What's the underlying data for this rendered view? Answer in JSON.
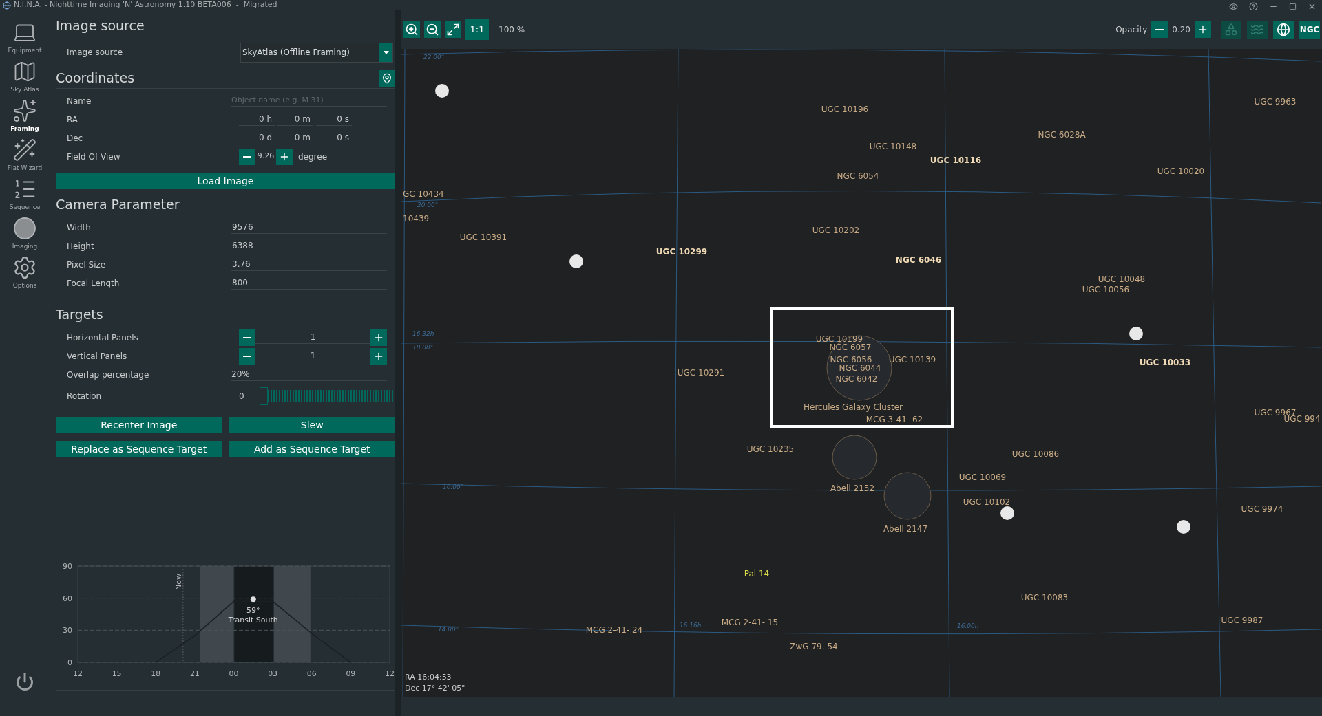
{
  "window": {
    "title": "N.I.N.A. - Nighttime Imaging 'N' Astronomy 1.10 BETA006  -  Migrated"
  },
  "sidebar": {
    "items": [
      {
        "label": "Equipment",
        "kind": "equipment",
        "selected": false
      },
      {
        "label": "Sky Atlas",
        "kind": "atlas",
        "selected": false
      },
      {
        "label": "Framing",
        "kind": "framing",
        "selected": true
      },
      {
        "label": "Flat Wizard",
        "kind": "flat",
        "selected": false
      },
      {
        "label": "Sequence",
        "kind": "sequence",
        "selected": false
      },
      {
        "label": "Imaging",
        "kind": "imaging",
        "selected": false
      },
      {
        "label": "Options",
        "kind": "options",
        "selected": false
      }
    ]
  },
  "image_source": {
    "title": "Image source",
    "label": "Image source",
    "value": "SkyAtlas (Offline Framing)"
  },
  "coordinates": {
    "title": "Coordinates",
    "name": {
      "label": "Name",
      "placeholder": "Object name (e.g. M 31)"
    },
    "ra": {
      "label": "RA",
      "parts": [
        {
          "value": "0",
          "unit": "h"
        },
        {
          "value": "0",
          "unit": "m"
        },
        {
          "value": "0",
          "unit": "s"
        }
      ]
    },
    "dec": {
      "label": "Dec",
      "parts": [
        {
          "value": "0",
          "unit": "d"
        },
        {
          "value": "0",
          "unit": "m"
        },
        {
          "value": "0",
          "unit": "s"
        }
      ]
    },
    "fov": {
      "label": "Field Of View",
      "value": "9.26",
      "unit": "degree"
    },
    "load_button": "Load Image"
  },
  "camera": {
    "title": "Camera Parameter",
    "fields": [
      {
        "label": "Width",
        "value": "9576"
      },
      {
        "label": "Height",
        "value": "6388"
      },
      {
        "label": "Pixel Size",
        "value": "3.76"
      },
      {
        "label": "Focal Length",
        "value": "800"
      }
    ]
  },
  "targets": {
    "title": "Targets",
    "panels": [
      {
        "label": "Horizontal Panels",
        "value": "1"
      },
      {
        "label": "Vertical Panels",
        "value": "1"
      }
    ],
    "overlap": {
      "label": "Overlap percentage",
      "value": "20%"
    },
    "rotation": {
      "label": "Rotation",
      "value": "0",
      "level": 0
    }
  },
  "actions": [
    "Recenter Image",
    "Slew",
    "Replace as Sequence Target",
    "Add as Sequence Target"
  ],
  "altitude_chart": {
    "now_label": "Now",
    "peak_label": "59°",
    "transit_label": "Transit South",
    "chart_data": {
      "type": "line",
      "categories": [
        "12",
        "15",
        "18",
        "21",
        "00",
        "03",
        "06",
        "09",
        "12"
      ],
      "yticks": [
        0,
        30,
        60,
        90
      ],
      "ylim": [
        0,
        90
      ],
      "series": [
        {
          "color": "#1a1f22",
          "values": [
            null,
            null,
            0,
            25,
            57,
            57,
            27,
            0,
            null
          ]
        }
      ]
    }
  },
  "map_toolbar": {
    "one_to_one": "1:1",
    "zoom": "100 %",
    "opacity_label": "Opacity",
    "opacity_value": "0.20",
    "toggles": [
      {
        "kind": "outline",
        "on": false
      },
      {
        "kind": "milkyway",
        "on": false
      },
      {
        "kind": "grid",
        "on": true
      },
      {
        "kind": "ngc",
        "label": "NGC",
        "on": true
      }
    ]
  },
  "sky_map": {
    "grid_labels": [
      "22.00°",
      "20.00°",
      "18.00°",
      "16.00°",
      "14.00°",
      "16.32h",
      "16.16h",
      "16.00h"
    ],
    "objects": [
      {
        "label": "UGC 10196",
        "kind": "galaxy"
      },
      {
        "label": "UGC 10148",
        "kind": "galaxy"
      },
      {
        "label": "UGC 10116",
        "kind": "bright"
      },
      {
        "label": "NGC 6028A",
        "kind": "galaxy"
      },
      {
        "label": "NGC 6054",
        "kind": "galaxy"
      },
      {
        "label": "UGC 9963",
        "kind": "galaxy"
      },
      {
        "label": "UGC 10020",
        "kind": "galaxy"
      },
      {
        "label": "GC 10434",
        "kind": "galaxy"
      },
      {
        "label": "10439",
        "kind": "galaxy"
      },
      {
        "label": "UGC 10391",
        "kind": "galaxy"
      },
      {
        "label": "UGC 10299",
        "kind": "bright"
      },
      {
        "label": "UGC 10202",
        "kind": "galaxy"
      },
      {
        "label": "NGC 6046",
        "kind": "bright"
      },
      {
        "label": "UGC 10048",
        "kind": "galaxy"
      },
      {
        "label": "UGC 10056",
        "kind": "galaxy"
      },
      {
        "label": "UGC 10199",
        "kind": "galaxy"
      },
      {
        "label": "NGC 6057",
        "kind": "galaxy"
      },
      {
        "label": "NGC 6056",
        "kind": "galaxy"
      },
      {
        "label": "NGC 6044",
        "kind": "galaxy"
      },
      {
        "label": "NGC 6042",
        "kind": "galaxy"
      },
      {
        "label": "UGC 10139",
        "kind": "galaxy"
      },
      {
        "label": "Hercules Galaxy Cluster",
        "kind": "galaxy"
      },
      {
        "label": "MCG 3-41- 62",
        "kind": "galaxy"
      },
      {
        "label": "UGC 10291",
        "kind": "galaxy"
      },
      {
        "label": "UGC 10033",
        "kind": "bright"
      },
      {
        "label": "UGC 9967",
        "kind": "galaxy"
      },
      {
        "label": "UGC 994",
        "kind": "galaxy"
      },
      {
        "label": "UGC 10235",
        "kind": "galaxy"
      },
      {
        "label": "UGC 10086",
        "kind": "galaxy"
      },
      {
        "label": "Abell 2152",
        "kind": "galaxy"
      },
      {
        "label": "Abell 2147",
        "kind": "galaxy"
      },
      {
        "label": "UGC 10069",
        "kind": "galaxy"
      },
      {
        "label": "UGC 10102",
        "kind": "galaxy"
      },
      {
        "label": "UGC 9974",
        "kind": "galaxy"
      },
      {
        "label": "Pal 14",
        "kind": "cluster"
      },
      {
        "label": "UGC 10083",
        "kind": "galaxy"
      },
      {
        "label": "UGC 9987",
        "kind": "galaxy"
      },
      {
        "label": "MCG 2-41- 24",
        "kind": "galaxy"
      },
      {
        "label": "MCG 2-41- 15",
        "kind": "galaxy"
      },
      {
        "label": "ZwG 79. 54",
        "kind": "galaxy"
      }
    ],
    "cursor": {
      "ra": "RA 16:04:53",
      "dec": "Dec 17° 42' 05\""
    }
  }
}
